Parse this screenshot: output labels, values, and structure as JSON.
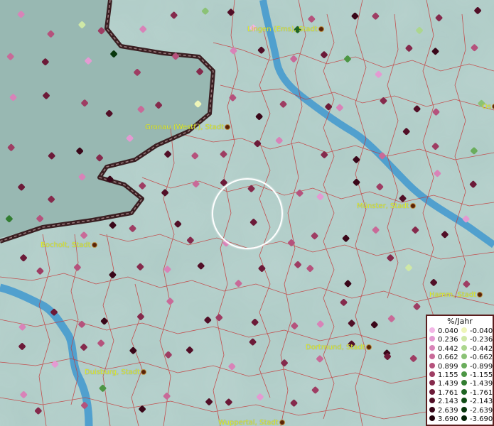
{
  "legend": {
    "title": "%/Jahr",
    "positive": [
      {
        "label": "0.040",
        "color": "#f2b6e6"
      },
      {
        "label": "0.236",
        "color": "#e49ad2"
      },
      {
        "label": "0.442",
        "color": "#d883b8"
      },
      {
        "label": "0.662",
        "color": "#c86a98"
      },
      {
        "label": "0.899",
        "color": "#b5527c"
      },
      {
        "label": "1.155",
        "color": "#9e3d63"
      },
      {
        "label": "1.439",
        "color": "#852a4c"
      },
      {
        "label": "1.761",
        "color": "#6c1a38"
      },
      {
        "label": "2.143",
        "color": "#520f27"
      },
      {
        "label": "2.639",
        "color": "#3a0719"
      },
      {
        "label": "3.690",
        "color": "#23030d"
      }
    ],
    "negative": [
      {
        "label": "-0.040",
        "color": "#eef5b8"
      },
      {
        "label": "-0.236",
        "color": "#cfe8a6"
      },
      {
        "label": "-0.442",
        "color": "#acd68e"
      },
      {
        "label": "-0.662",
        "color": "#8bc276"
      },
      {
        "label": "-0.899",
        "color": "#6aad5c"
      },
      {
        "label": "-1.155",
        "color": "#4c9644"
      },
      {
        "label": "-1.439",
        "color": "#327d31"
      },
      {
        "label": "-1.761",
        "color": "#1f6522"
      },
      {
        "label": "-2.143",
        "color": "#114d16"
      },
      {
        "label": "-2.639",
        "color": "#08370d"
      },
      {
        "label": "-3.690",
        "color": "#032206"
      }
    ]
  },
  "cities": [
    {
      "name": "Lingen (Ems), Stadt"
    },
    {
      "name": "Gronau (Westf.), Stadt"
    },
    {
      "name": "Münster, Stadt"
    },
    {
      "name": "Bocholt, Stadt"
    },
    {
      "name": "Hamm, Stadt"
    },
    {
      "name": "Dortmund, Stadt"
    },
    {
      "name": "Duisburg, Stadt"
    },
    {
      "name": "Wuppertal, Stadt"
    },
    {
      "name": "Os"
    }
  ],
  "points": [
    {
      "v": 2,
      "c": "p"
    },
    {
      "v": 4,
      "c": "p"
    },
    {
      "v": 1,
      "c": "n"
    },
    {
      "v": 5,
      "c": "p"
    },
    {
      "v": 2,
      "c": "p"
    },
    {
      "v": 6,
      "c": "p"
    },
    {
      "v": 3,
      "c": "n"
    },
    {
      "v": 8,
      "c": "p"
    },
    {
      "v": 0,
      "c": "p"
    },
    {
      "v": 7,
      "c": "n"
    },
    {
      "v": 4,
      "c": "p"
    },
    {
      "v": 9,
      "c": "p"
    },
    {
      "v": 5,
      "c": "p"
    },
    {
      "v": 2,
      "c": "n"
    },
    {
      "v": 6,
      "c": "p"
    },
    {
      "v": 8,
      "c": "p"
    },
    {
      "v": 3,
      "c": "p"
    },
    {
      "v": 7,
      "c": "p"
    },
    {
      "v": 1,
      "c": "p"
    },
    {
      "v": 9,
      "c": "n"
    },
    {
      "v": 5,
      "c": "p"
    },
    {
      "v": 4,
      "c": "p"
    },
    {
      "v": 6,
      "c": "p"
    },
    {
      "v": 2,
      "c": "p"
    },
    {
      "v": 8,
      "c": "p"
    },
    {
      "v": 3,
      "c": "p"
    },
    {
      "v": 7,
      "c": "p"
    },
    {
      "v": 5,
      "c": "n"
    },
    {
      "v": 1,
      "c": "p"
    },
    {
      "v": 6,
      "c": "p"
    },
    {
      "v": 9,
      "c": "p"
    },
    {
      "v": 4,
      "c": "p"
    },
    {
      "v": 2,
      "c": "p"
    },
    {
      "v": 7,
      "c": "p"
    },
    {
      "v": 5,
      "c": "p"
    },
    {
      "v": 8,
      "c": "p"
    },
    {
      "v": 3,
      "c": "p"
    },
    {
      "v": 6,
      "c": "p"
    },
    {
      "v": 0,
      "c": "n"
    },
    {
      "v": 4,
      "c": "p"
    },
    {
      "v": 9,
      "c": "p"
    },
    {
      "v": 5,
      "c": "p"
    },
    {
      "v": 7,
      "c": "p"
    },
    {
      "v": 2,
      "c": "p"
    },
    {
      "v": 6,
      "c": "p"
    },
    {
      "v": 8,
      "c": "p"
    },
    {
      "v": 4,
      "c": "p"
    },
    {
      "v": 3,
      "c": "n"
    },
    {
      "v": 5,
      "c": "p"
    },
    {
      "v": 7,
      "c": "p"
    },
    {
      "v": 9,
      "c": "p"
    },
    {
      "v": 6,
      "c": "p"
    },
    {
      "v": 1,
      "c": "p"
    },
    {
      "v": 8,
      "c": "p"
    },
    {
      "v": 4,
      "c": "p"
    },
    {
      "v": 5,
      "c": "p"
    },
    {
      "v": 7,
      "c": "p"
    },
    {
      "v": 2,
      "c": "p"
    },
    {
      "v": 6,
      "c": "p"
    },
    {
      "v": 9,
      "c": "p"
    },
    {
      "v": 3,
      "c": "p"
    },
    {
      "v": 8,
      "c": "p"
    },
    {
      "v": 5,
      "c": "p"
    },
    {
      "v": 4,
      "c": "n"
    },
    {
      "v": 7,
      "c": "p"
    },
    {
      "v": 6,
      "c": "p"
    },
    {
      "v": 2,
      "c": "p"
    },
    {
      "v": 9,
      "c": "p"
    },
    {
      "v": 5,
      "c": "p"
    },
    {
      "v": 8,
      "c": "p"
    },
    {
      "v": 3,
      "c": "p"
    },
    {
      "v": 7,
      "c": "p"
    },
    {
      "v": 6,
      "c": "p"
    },
    {
      "v": 4,
      "c": "p"
    },
    {
      "v": 1,
      "c": "p"
    },
    {
      "v": 9,
      "c": "p"
    },
    {
      "v": 5,
      "c": "p"
    },
    {
      "v": 8,
      "c": "p"
    },
    {
      "v": 2,
      "c": "p"
    },
    {
      "v": 7,
      "c": "p"
    },
    {
      "v": 6,
      "c": "n"
    },
    {
      "v": 4,
      "c": "p"
    },
    {
      "v": 3,
      "c": "p"
    },
    {
      "v": 9,
      "c": "p"
    },
    {
      "v": 5,
      "c": "p"
    },
    {
      "v": 8,
      "c": "p"
    },
    {
      "v": 6,
      "c": "p"
    },
    {
      "v": 2,
      "c": "p"
    },
    {
      "v": 7,
      "c": "p"
    },
    {
      "v": 4,
      "c": "p"
    },
    {
      "v": 5,
      "c": "p"
    },
    {
      "v": 9,
      "c": "p"
    },
    {
      "v": 3,
      "c": "p"
    },
    {
      "v": 6,
      "c": "p"
    },
    {
      "v": 8,
      "c": "p"
    },
    {
      "v": 1,
      "c": "p"
    },
    {
      "v": 7,
      "c": "p"
    },
    {
      "v": 5,
      "c": "p"
    },
    {
      "v": 4,
      "c": "p"
    },
    {
      "v": 9,
      "c": "p"
    },
    {
      "v": 6,
      "c": "p"
    },
    {
      "v": 2,
      "c": "p"
    },
    {
      "v": 8,
      "c": "p"
    },
    {
      "v": 3,
      "c": "p"
    },
    {
      "v": 7,
      "c": "p"
    },
    {
      "v": 5,
      "c": "p"
    },
    {
      "v": 4,
      "c": "p"
    },
    {
      "v": 9,
      "c": "p"
    },
    {
      "v": 6,
      "c": "p"
    },
    {
      "v": 1,
      "c": "n"
    },
    {
      "v": 8,
      "c": "p"
    },
    {
      "v": 5,
      "c": "p"
    },
    {
      "v": 2,
      "c": "p"
    },
    {
      "v": 7,
      "c": "p"
    },
    {
      "v": 4,
      "c": "p"
    },
    {
      "v": 9,
      "c": "p"
    },
    {
      "v": 6,
      "c": "p"
    },
    {
      "v": 3,
      "c": "p"
    },
    {
      "v": 8,
      "c": "p"
    },
    {
      "v": 5,
      "c": "p"
    },
    {
      "v": 7,
      "c": "p"
    },
    {
      "v": 4,
      "c": "p"
    },
    {
      "v": 2,
      "c": "p"
    },
    {
      "v": 6,
      "c": "p"
    },
    {
      "v": 9,
      "c": "p"
    },
    {
      "v": 5,
      "c": "p"
    },
    {
      "v": 8,
      "c": "p"
    },
    {
      "v": 3,
      "c": "p"
    },
    {
      "v": 7,
      "c": "p"
    },
    {
      "v": 1,
      "c": "p"
    },
    {
      "v": 6,
      "c": "p"
    },
    {
      "v": 4,
      "c": "p"
    },
    {
      "v": 9,
      "c": "p"
    },
    {
      "v": 5,
      "c": "p"
    },
    {
      "v": 8,
      "c": "p"
    },
    {
      "v": 2,
      "c": "p"
    },
    {
      "v": 7,
      "c": "p"
    },
    {
      "v": 6,
      "c": "p"
    },
    {
      "v": 3,
      "c": "p"
    },
    {
      "v": 4,
      "c": "p"
    },
    {
      "v": 9,
      "c": "p"
    },
    {
      "v": 5,
      "c": "p"
    },
    {
      "v": 8,
      "c": "p"
    },
    {
      "v": 7,
      "c": "p"
    },
    {
      "v": 2,
      "c": "p"
    },
    {
      "v": 6,
      "c": "p"
    },
    {
      "v": 4,
      "c": "p"
    },
    {
      "v": 5,
      "c": "n"
    },
    {
      "v": 9,
      "c": "p"
    },
    {
      "v": 3,
      "c": "p"
    },
    {
      "v": 8,
      "c": "p"
    },
    {
      "v": 7,
      "c": "p"
    },
    {
      "v": 1,
      "c": "p"
    },
    {
      "v": 6,
      "c": "p"
    },
    {
      "v": 5,
      "c": "p"
    }
  ]
}
